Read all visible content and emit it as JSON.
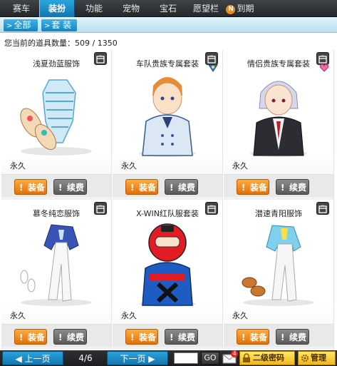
{
  "topnav": {
    "tabs": [
      {
        "label": "赛车"
      },
      {
        "label": "装扮"
      },
      {
        "label": "功能"
      },
      {
        "label": "宠物"
      },
      {
        "label": "宝石"
      },
      {
        "label": "愿望栏"
      },
      {
        "label": "到期"
      }
    ],
    "badge": "N"
  },
  "subnav": {
    "all_label": "全部",
    "suit_label": "套 装"
  },
  "inventory": {
    "count_text": "您当前的道具数量：509 / 1350"
  },
  "items": [
    {
      "name": "浅夏劲蓝服饰",
      "duration": "永久",
      "equip_label": "装备",
      "renew_label": "续费"
    },
    {
      "name": "车队贵族专属套装",
      "duration": "永久",
      "equip_label": "装备",
      "renew_label": "续费"
    },
    {
      "name": "情侣贵族专属套装",
      "duration": "永久",
      "equip_label": "装备",
      "renew_label": "续费"
    },
    {
      "name": "慕冬纯恋服饰",
      "duration": "永久",
      "equip_label": "装备",
      "renew_label": "续费"
    },
    {
      "name": "X-WIN红队服套装",
      "duration": "永久",
      "equip_label": "装备",
      "renew_label": "续费"
    },
    {
      "name": "潜速青阳服饰",
      "duration": "永久",
      "equip_label": "装备",
      "renew_label": "续费"
    }
  ],
  "footer": {
    "prev_label": "上一页",
    "page_info": "4/6",
    "next_label": "下一页",
    "go_label": "GO",
    "mail_count": "4",
    "password_label": "二级密码",
    "manage_label": "管理"
  }
}
